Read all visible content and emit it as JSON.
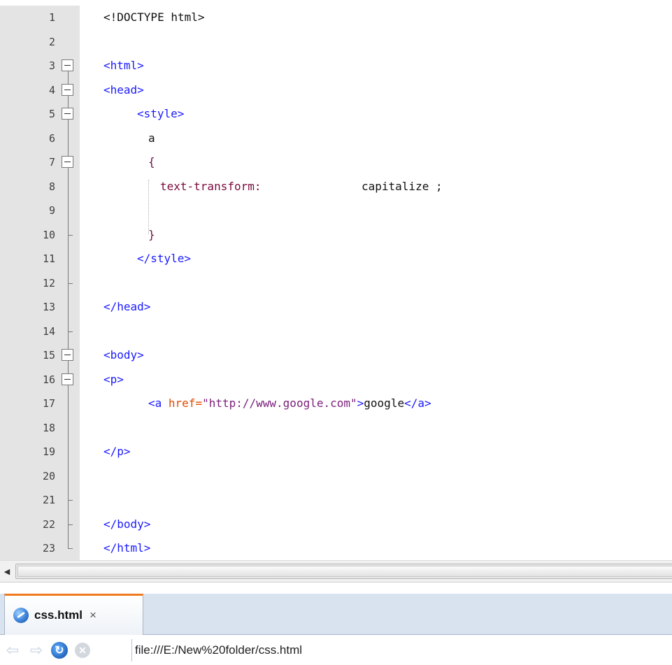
{
  "editor": {
    "lines": [
      {
        "n": "1"
      },
      {
        "n": "2"
      },
      {
        "n": "3"
      },
      {
        "n": "4"
      },
      {
        "n": "5"
      },
      {
        "n": "6"
      },
      {
        "n": "7"
      },
      {
        "n": "8"
      },
      {
        "n": "9"
      },
      {
        "n": "10"
      },
      {
        "n": "11"
      },
      {
        "n": "12"
      },
      {
        "n": "13"
      },
      {
        "n": "14"
      },
      {
        "n": "15"
      },
      {
        "n": "16"
      },
      {
        "n": "17"
      },
      {
        "n": "18"
      },
      {
        "n": "19"
      },
      {
        "n": "20"
      },
      {
        "n": "21"
      },
      {
        "n": "22"
      },
      {
        "n": "23"
      }
    ],
    "code": {
      "l1": "<!DOCTYPE html>",
      "l3": "<html>",
      "l4": "<head>",
      "l5": "<style>",
      "l6": "a",
      "l7": "{",
      "l8_prop": "text-transform:",
      "l8_val": "capitalize ;",
      "l10": "}",
      "l11": "</style>",
      "l13": "</head>",
      "l15": "<body>",
      "l16": "<p>",
      "l17_open": "<a ",
      "l17_attr": "href=",
      "l17_str": "\"http://www.google.com\"",
      "l17_gt": ">",
      "l17_text": "google",
      "l17_close": "</a>",
      "l19": "</p>",
      "l22": "</body>",
      "l23": "</html>"
    }
  },
  "tab": {
    "title": "css.html",
    "close": "×",
    "icon": "browser-globe-icon"
  },
  "nav": {
    "back_icon": "back-arrow-icon",
    "forward_icon": "forward-arrow-icon",
    "refresh_icon": "refresh-icon",
    "stop_icon": "stop-icon"
  },
  "address": {
    "url": "file:///E:/New%20folder/css.html"
  },
  "colors": {
    "tag": "#1a1aff",
    "property": "#7a0a3e",
    "attribute": "#e04a00",
    "string": "#7a1e7a",
    "tab_accent": "#f07a1e",
    "gutter": "#e4e4e4"
  }
}
